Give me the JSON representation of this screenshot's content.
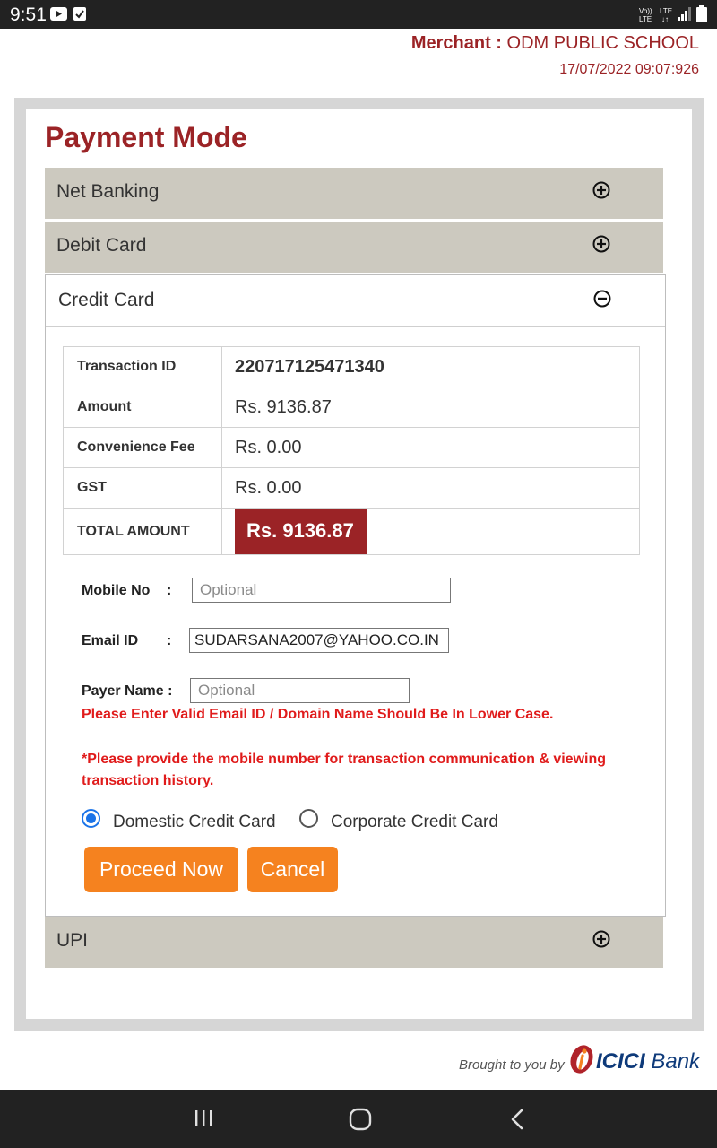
{
  "status_bar": {
    "time": "9:51"
  },
  "merchant": {
    "label": "Merchant :",
    "name": "ODM PUBLIC SCHOOL",
    "datetime": "17/07/2022 09:07:926"
  },
  "page_title": "Payment Mode",
  "accordion": {
    "net_banking": "Net Banking",
    "debit_card": "Debit Card",
    "credit_card": "Credit Card",
    "upi": "UPI"
  },
  "transaction": {
    "rows": [
      {
        "key": "Transaction ID",
        "value": "220717125471340"
      },
      {
        "key": "Amount",
        "value": "Rs. 9136.87"
      },
      {
        "key": "Convenience Fee",
        "value": "Rs. 0.00"
      },
      {
        "key": "GST",
        "value": "Rs. 0.00"
      }
    ],
    "total_label": "TOTAL AMOUNT",
    "total_value": "Rs. 9136.87"
  },
  "form": {
    "mobile_label": "Mobile No",
    "colon": ":",
    "mobile_placeholder": "Optional",
    "email_label": "Email ID",
    "email_value": "SUDARSANA2007@YAHOO.CO.IN",
    "payer_label": "Payer Name :",
    "payer_placeholder": "Optional",
    "error_email": "Please Enter Valid Email ID / Domain Name Should Be In Lower Case.",
    "note_line1": "*Please provide the mobile number for transaction communication & viewing",
    "note_line2": "transaction history."
  },
  "card_type": {
    "domestic": "Domestic Credit Card",
    "corporate": "Corporate Credit Card",
    "selected": "domestic"
  },
  "buttons": {
    "proceed": "Proceed Now",
    "cancel": "Cancel"
  },
  "footer": {
    "brought_by": "Brought to you by",
    "bank_name_1": "ICICI",
    "bank_name_2": "Bank"
  },
  "colors": {
    "brand_red": "#9b2326",
    "accent_orange": "#f5821f",
    "accordion_bg": "#ccc9bf",
    "error_red": "#e01b1b"
  },
  "icons": [
    "youtube-icon",
    "checkbox-icon",
    "volte-icon",
    "lte-icon",
    "signal-icon",
    "battery-icon",
    "expand-icon",
    "collapse-icon",
    "icici-logo-icon",
    "recents-icon",
    "home-icon",
    "back-icon"
  ]
}
